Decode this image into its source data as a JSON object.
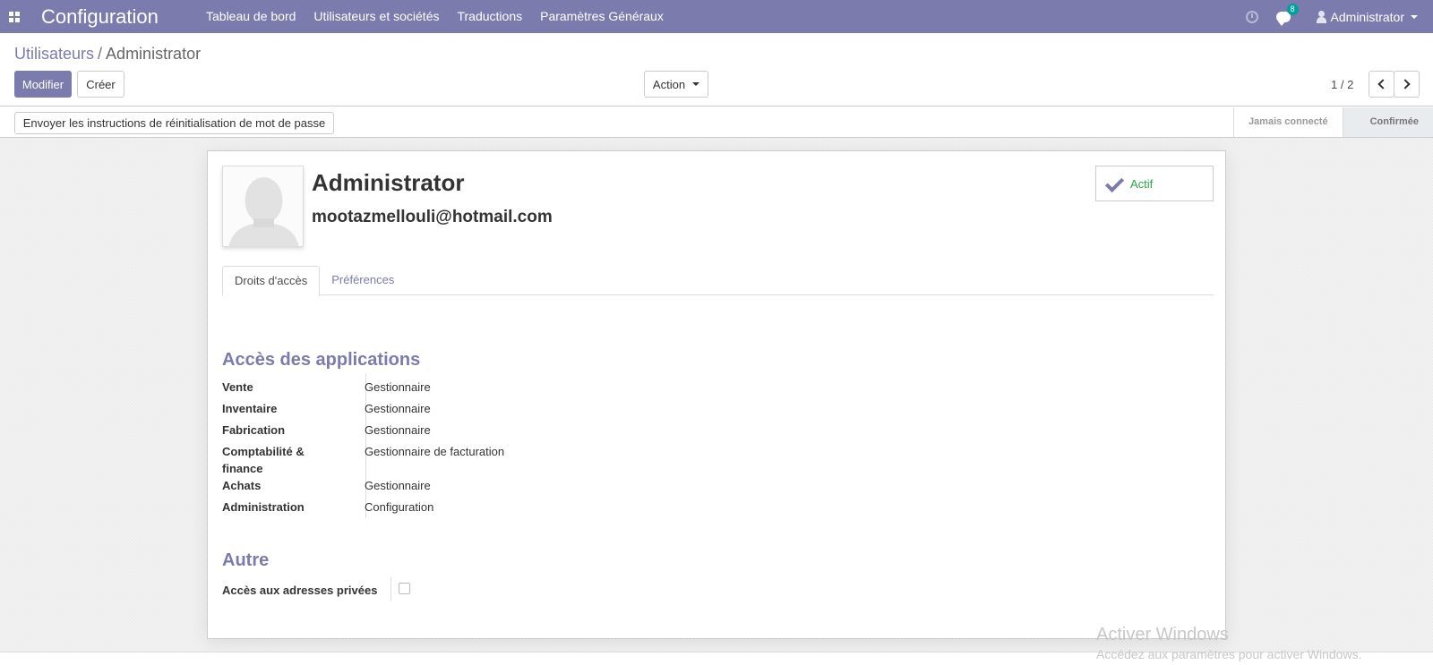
{
  "navbar": {
    "app_title": "Configuration",
    "menu": [
      "Tableau de bord",
      "Utilisateurs et sociétés",
      "Traductions",
      "Paramètres Généraux"
    ],
    "message_count": "8",
    "user_name": "Administrator"
  },
  "breadcrumb": {
    "parent": "Utilisateurs",
    "separator": "/",
    "current": "Administrator"
  },
  "buttons": {
    "edit": "Modifier",
    "create": "Créer",
    "action": "Action",
    "reset_password": "Envoyer les instructions de réinitialisation de mot de passe"
  },
  "pager": {
    "value": "1 / 2"
  },
  "status": {
    "steps": [
      "Jamais connecté",
      "Confirmée"
    ],
    "current": "Confirmée"
  },
  "user": {
    "name": "Administrator",
    "email": "mootazmellouli@hotmail.com",
    "active_label": "Actif"
  },
  "tabs": [
    "Droits d'accès",
    "Préférences"
  ],
  "access": {
    "title": "Accès des applications",
    "rows": [
      {
        "label": "Vente",
        "value": "Gestionnaire"
      },
      {
        "label": "Inventaire",
        "value": "Gestionnaire"
      },
      {
        "label": "Fabrication",
        "value": "Gestionnaire"
      },
      {
        "label": "Comptabilité & finance",
        "value": "Gestionnaire de facturation"
      },
      {
        "label": "Achats",
        "value": "Gestionnaire"
      },
      {
        "label": "Administration",
        "value": "Configuration"
      }
    ]
  },
  "other": {
    "title": "Autre",
    "private_address_label": "Accès aux adresses privées",
    "private_address_checked": false
  },
  "watermark": {
    "line1": "Activer Windows",
    "line2": "Accédez aux paramètres pour activer Windows."
  }
}
